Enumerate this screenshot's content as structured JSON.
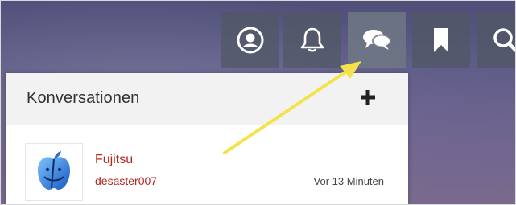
{
  "topbar": {
    "buttons": [
      {
        "name": "profile",
        "icon": "user-circle-icon"
      },
      {
        "name": "notifications",
        "icon": "bell-icon"
      },
      {
        "name": "conversations",
        "icon": "chat-bubbles-icon"
      },
      {
        "name": "bookmarks",
        "icon": "bookmark-icon"
      },
      {
        "name": "search",
        "icon": "search-icon"
      }
    ]
  },
  "panel": {
    "title": "Konversationen",
    "add_icon": "plus-icon",
    "conversation": {
      "avatar_icon": "mac-finder-icon",
      "title": "Fujitsu",
      "user": "desaster007",
      "time": "Vor 13 Minuten"
    }
  },
  "annotation": {
    "arrow_color": "#f3e24b"
  },
  "colors": {
    "link_red": "#b3261e",
    "header_bg": "#f2f2f3"
  }
}
